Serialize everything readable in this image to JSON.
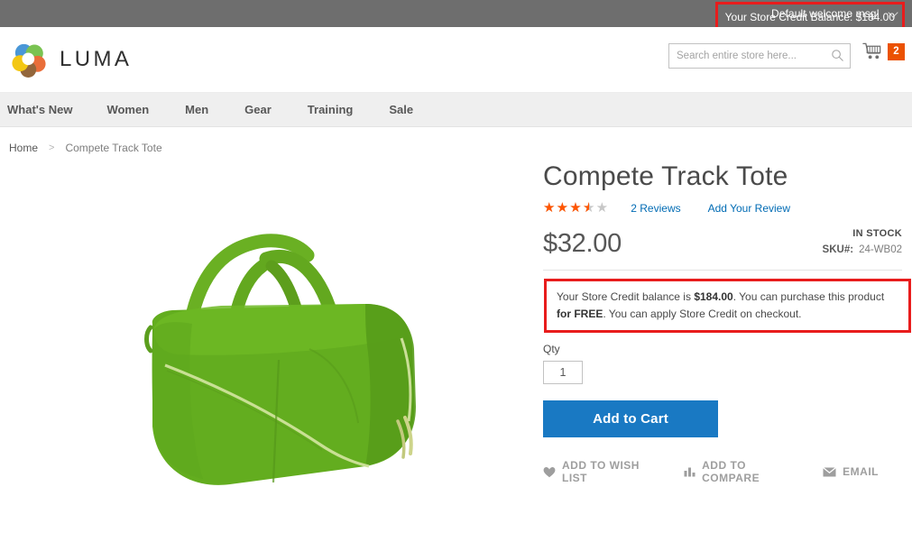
{
  "top_panel": {
    "welcome_message": "Default welcome msg!",
    "dropdown_icon": "chevron-down-icon",
    "store_credit_balance_link": "Your Store Credit Balance: $184.00",
    "highlight_color": "#e81c1c",
    "background_color": "#6e6e6e"
  },
  "header": {
    "logo_text": "LUMA",
    "logo_icon": "luma-flower-logo",
    "search": {
      "placeholder": "Search entire store here...",
      "value": "",
      "icon": "search-icon"
    },
    "cart": {
      "icon": "shopping-cart-icon",
      "count": "2",
      "counter_color": "#eb5202"
    }
  },
  "nav": {
    "items": [
      {
        "label": "What's New"
      },
      {
        "label": "Women"
      },
      {
        "label": "Men"
      },
      {
        "label": "Gear"
      },
      {
        "label": "Training"
      },
      {
        "label": "Sale"
      }
    ]
  },
  "breadcrumb": {
    "home": "Home",
    "separator": ">",
    "current": "Compete Track Tote"
  },
  "product": {
    "title": "Compete Track Tote",
    "image_alt": "green-tote-bag-photo",
    "rating": {
      "percent": 70,
      "stars_glyphs": "★★★★★",
      "reviews_link": "2 Reviews",
      "add_review_link": "Add Your Review",
      "filled_color": "#ff5501",
      "empty_color": "#c7c7c7"
    },
    "price": "$32.00",
    "availability": "IN STOCK",
    "sku_label": "SKU#:",
    "sku_value": "24-WB02",
    "store_credit_notice": {
      "part1": "Your Store Credit balance is ",
      "amount": "$184.00",
      "part2": ". You can purchase this product ",
      "free": "for FREE",
      "part3": ". You can apply Store Credit on checkout."
    },
    "qty_label": "Qty",
    "qty_value": "1",
    "add_to_cart_label": "Add to Cart",
    "add_to_cart_color": "#1979c3",
    "actions": [
      {
        "label": "ADD TO WISH LIST",
        "icon": "heart-icon"
      },
      {
        "label": "ADD TO COMPARE",
        "icon": "bar-chart-icon"
      },
      {
        "label": "EMAIL",
        "icon": "envelope-icon"
      }
    ]
  }
}
